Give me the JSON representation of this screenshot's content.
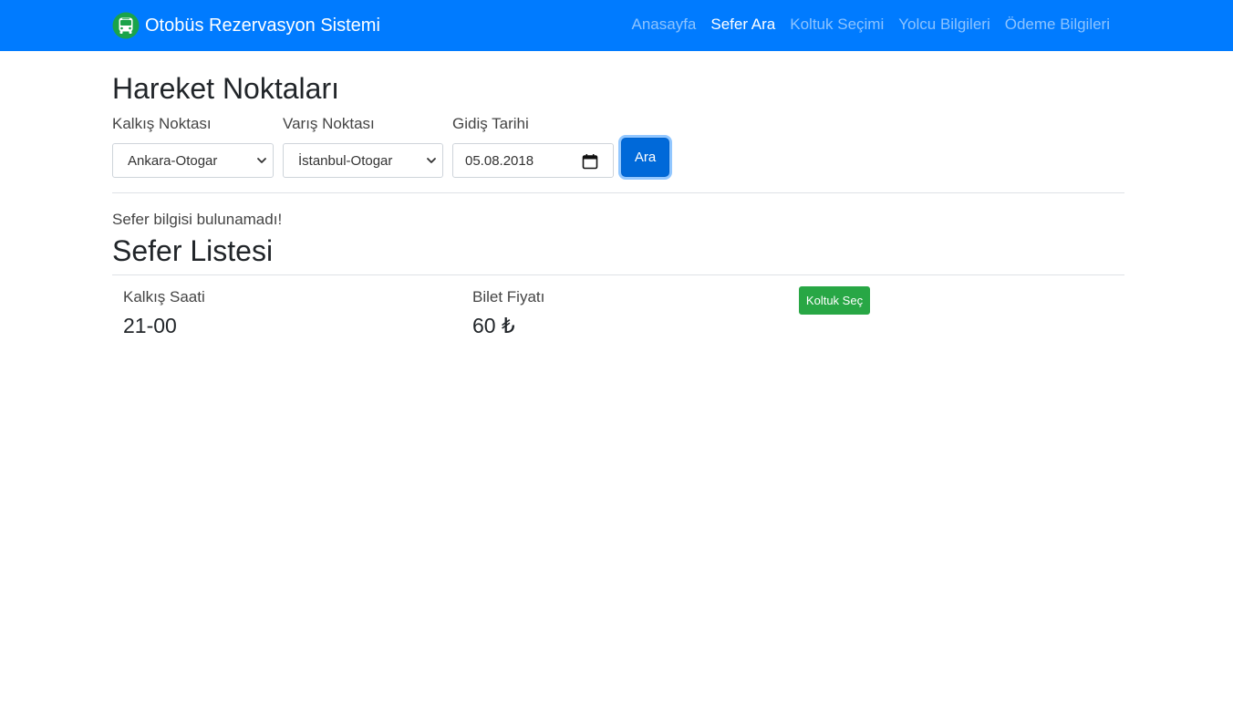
{
  "navbar": {
    "brand": "Otobüs Rezervasyon Sistemi",
    "brand_icon": "bus-icon",
    "links": [
      {
        "label": "Anasayfa",
        "active": false
      },
      {
        "label": "Sefer Ara",
        "active": true
      },
      {
        "label": "Koltuk Seçimi",
        "active": false
      },
      {
        "label": "Yolcu Bilgileri",
        "active": false
      },
      {
        "label": "Ödeme Bilgileri",
        "active": false
      }
    ],
    "background_color": "#007bff"
  },
  "search": {
    "title": "Hareket Noktaları",
    "departure_label": "Kalkış Noktası",
    "departure_value": "Ankara-Otogar",
    "arrival_label": "Varış Noktası",
    "arrival_value": "İstanbul-Otogar",
    "date_label": "Gidiş Tarihi",
    "date_value": "05.08.2018",
    "search_button": "Ara"
  },
  "notice": "Sefer bilgisi bulunamadı!",
  "trip_list": {
    "title": "Sefer Listesi",
    "trips": [
      {
        "departure_time_label": "Kalkış Saati",
        "departure_time": "21-00",
        "price_label": "Bilet Fiyatı",
        "price": "60 ₺",
        "select_button": "Koltuk Seç"
      }
    ]
  }
}
